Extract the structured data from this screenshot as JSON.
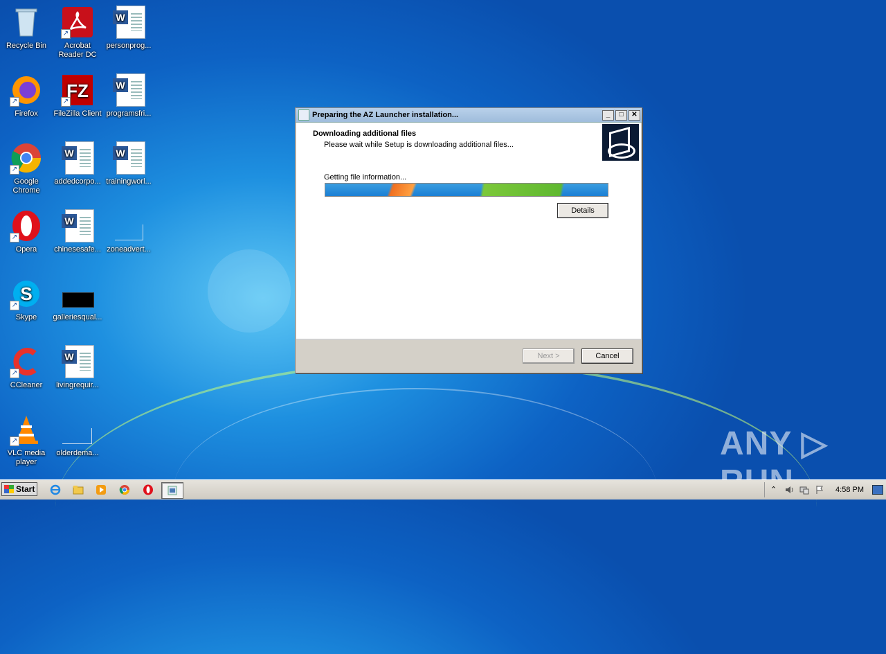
{
  "desktop": {
    "icons": [
      {
        "label": "Recycle Bin"
      },
      {
        "label": "Acrobat Reader DC"
      },
      {
        "label": "personprog..."
      },
      {
        "label": "Firefox"
      },
      {
        "label": "FileZilla Client"
      },
      {
        "label": "programsfri..."
      },
      {
        "label": "Google Chrome"
      },
      {
        "label": "addedcorpo..."
      },
      {
        "label": "trainingworl..."
      },
      {
        "label": "Opera"
      },
      {
        "label": "chinesesafe..."
      },
      {
        "label": "zoneadvert..."
      },
      {
        "label": "Skype"
      },
      {
        "label": "galleriesqual..."
      },
      {
        "label": "CCleaner"
      },
      {
        "label": "livingrequir..."
      },
      {
        "label": "VLC media player"
      },
      {
        "label": "olderdema..."
      }
    ]
  },
  "installer": {
    "title": "Preparing the AZ Launcher installation...",
    "header_title": "Downloading additional files",
    "header_subtitle": "Please wait while Setup is downloading additional files...",
    "status": "Getting file information...",
    "details_label": "Details",
    "next_label": "Next >",
    "cancel_label": "Cancel",
    "minimize_glyph": "_",
    "maximize_glyph": "□",
    "close_glyph": "✕"
  },
  "taskbar": {
    "start_label": "Start",
    "clock": "4:58 PM",
    "tray_chevron": "⌃"
  },
  "watermark": {
    "text": "ANY ▷ RUN"
  }
}
